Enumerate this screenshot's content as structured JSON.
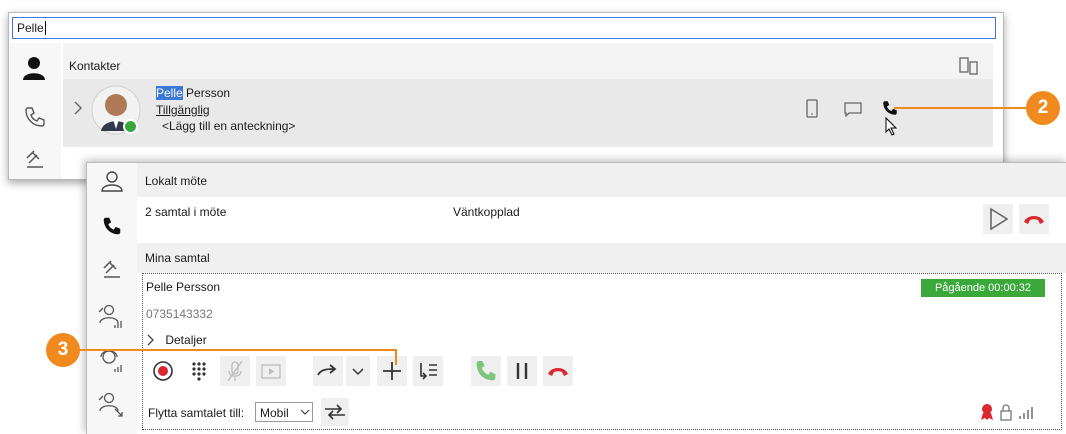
{
  "search": {
    "value": "Pelle",
    "highlight": "Pelle"
  },
  "contacts": {
    "header": "Kontakter",
    "contact": {
      "first_name": "Pelle",
      "last_name": "Persson",
      "status": "Tillgänglig",
      "note": "<Lägg till en anteckning>"
    }
  },
  "meeting": {
    "header": "Lokalt möte",
    "calls_count": "2 samtal i möte",
    "state": "Väntkopplad"
  },
  "my_calls": {
    "header": "Mina samtal",
    "name": "Pelle Persson",
    "number": "0735143332",
    "status": "Pågående 00:00:32",
    "details": "Detaljer",
    "move_label": "Flytta samtalet till:",
    "move_target": "Mobil"
  },
  "badges": {
    "two": "2",
    "three": "3"
  },
  "colors": {
    "accent_orange": "#f18a1e",
    "status_green": "#3aa83a",
    "hangup_red": "#d9282f",
    "search_border": "#3b78d8"
  }
}
